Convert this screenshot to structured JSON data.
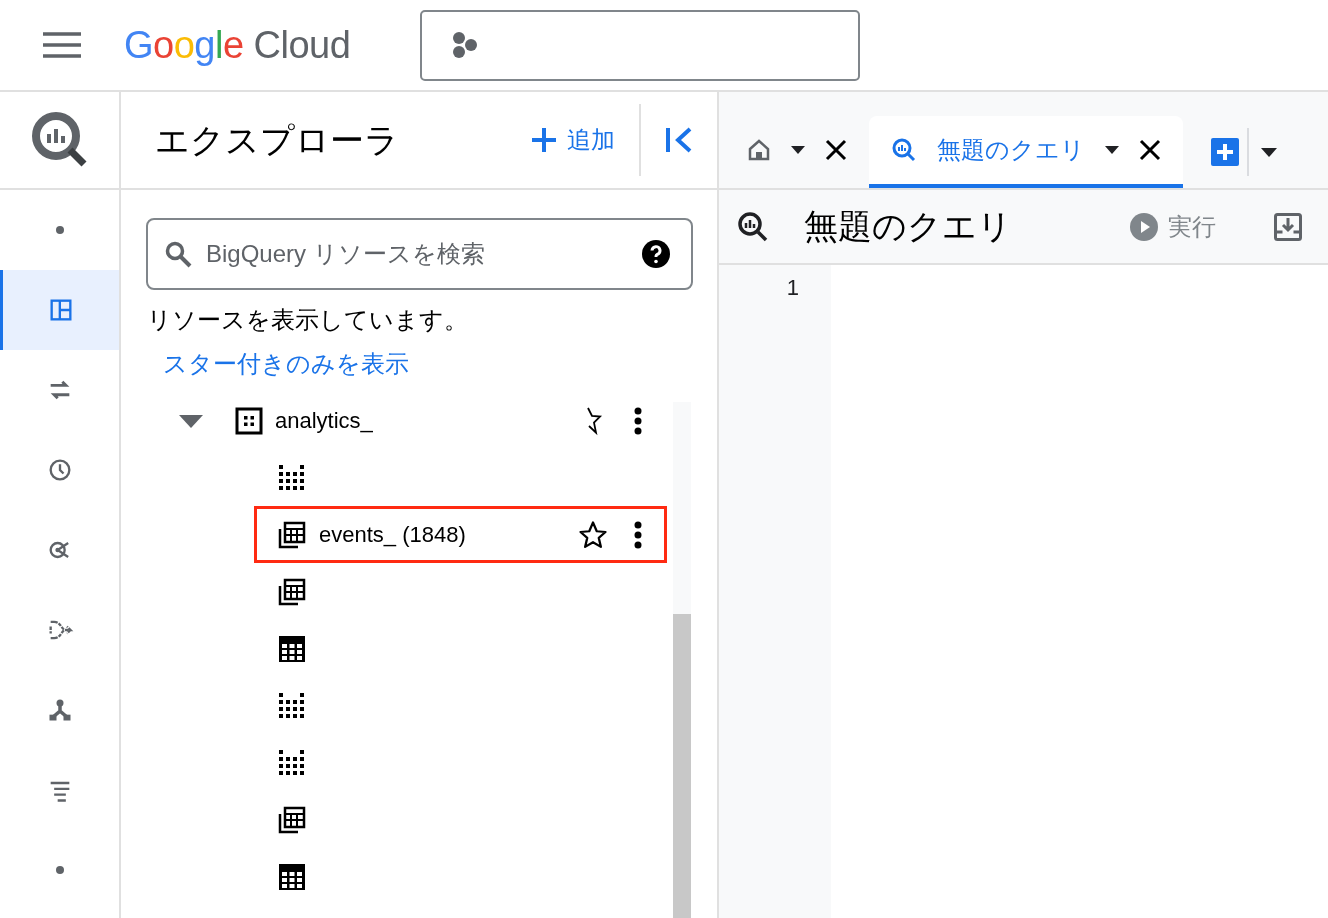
{
  "header": {
    "logo": {
      "google": "Google",
      "cloud": "Cloud"
    }
  },
  "rail": [
    {
      "selected": false
    },
    {
      "selected": true
    },
    {
      "selected": false
    },
    {
      "selected": false
    },
    {
      "selected": false
    },
    {
      "selected": false
    },
    {
      "selected": false
    },
    {
      "selected": false
    },
    {
      "selected": false
    }
  ],
  "explorer": {
    "title": "エクスプローラ",
    "add_button": "追加",
    "search": {
      "placeholder": "BigQuery リソースを検索"
    },
    "info": "リソースを表示しています。",
    "starred_link": "スター付きのみを表示",
    "tree": [
      {
        "kind": "dataset",
        "label": "analytics_",
        "expanded": true,
        "children": [
          {
            "kind": "view",
            "highlighted": false
          },
          {
            "kind": "sharded",
            "label": "events_ (1848)",
            "highlighted": true,
            "starred": false
          },
          {
            "kind": "sharded",
            "highlighted": false
          },
          {
            "kind": "table",
            "highlighted": false
          },
          {
            "kind": "view",
            "highlighted": false
          },
          {
            "kind": "view",
            "highlighted": false
          },
          {
            "kind": "sharded",
            "highlighted": false
          },
          {
            "kind": "table",
            "highlighted": false
          }
        ]
      }
    ]
  },
  "tabs": [
    {
      "kind": "home",
      "selected": false
    },
    {
      "kind": "query",
      "label": "無題のクエリ",
      "selected": true
    }
  ],
  "query": {
    "title": "無題のクエリ",
    "run_button": "実行",
    "line_numbers": [
      "1"
    ]
  }
}
